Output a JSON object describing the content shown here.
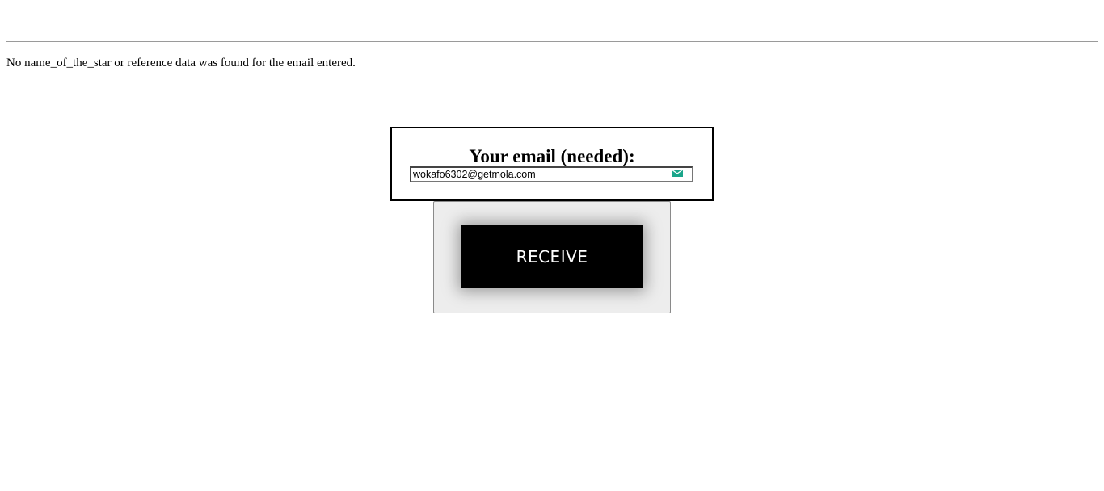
{
  "message": {
    "text": "No name_of_the_star or reference data was found for the email entered."
  },
  "email_form": {
    "heading": "Your email (needed):",
    "email_value": "wokafo6302@getmola.com",
    "field_icon": "envelope-icon"
  },
  "receive": {
    "button_label": "RECEIVE"
  },
  "colors": {
    "icon_green": "#1aa58a",
    "button_bg": "#000000",
    "panel_bg": "#ededed"
  }
}
